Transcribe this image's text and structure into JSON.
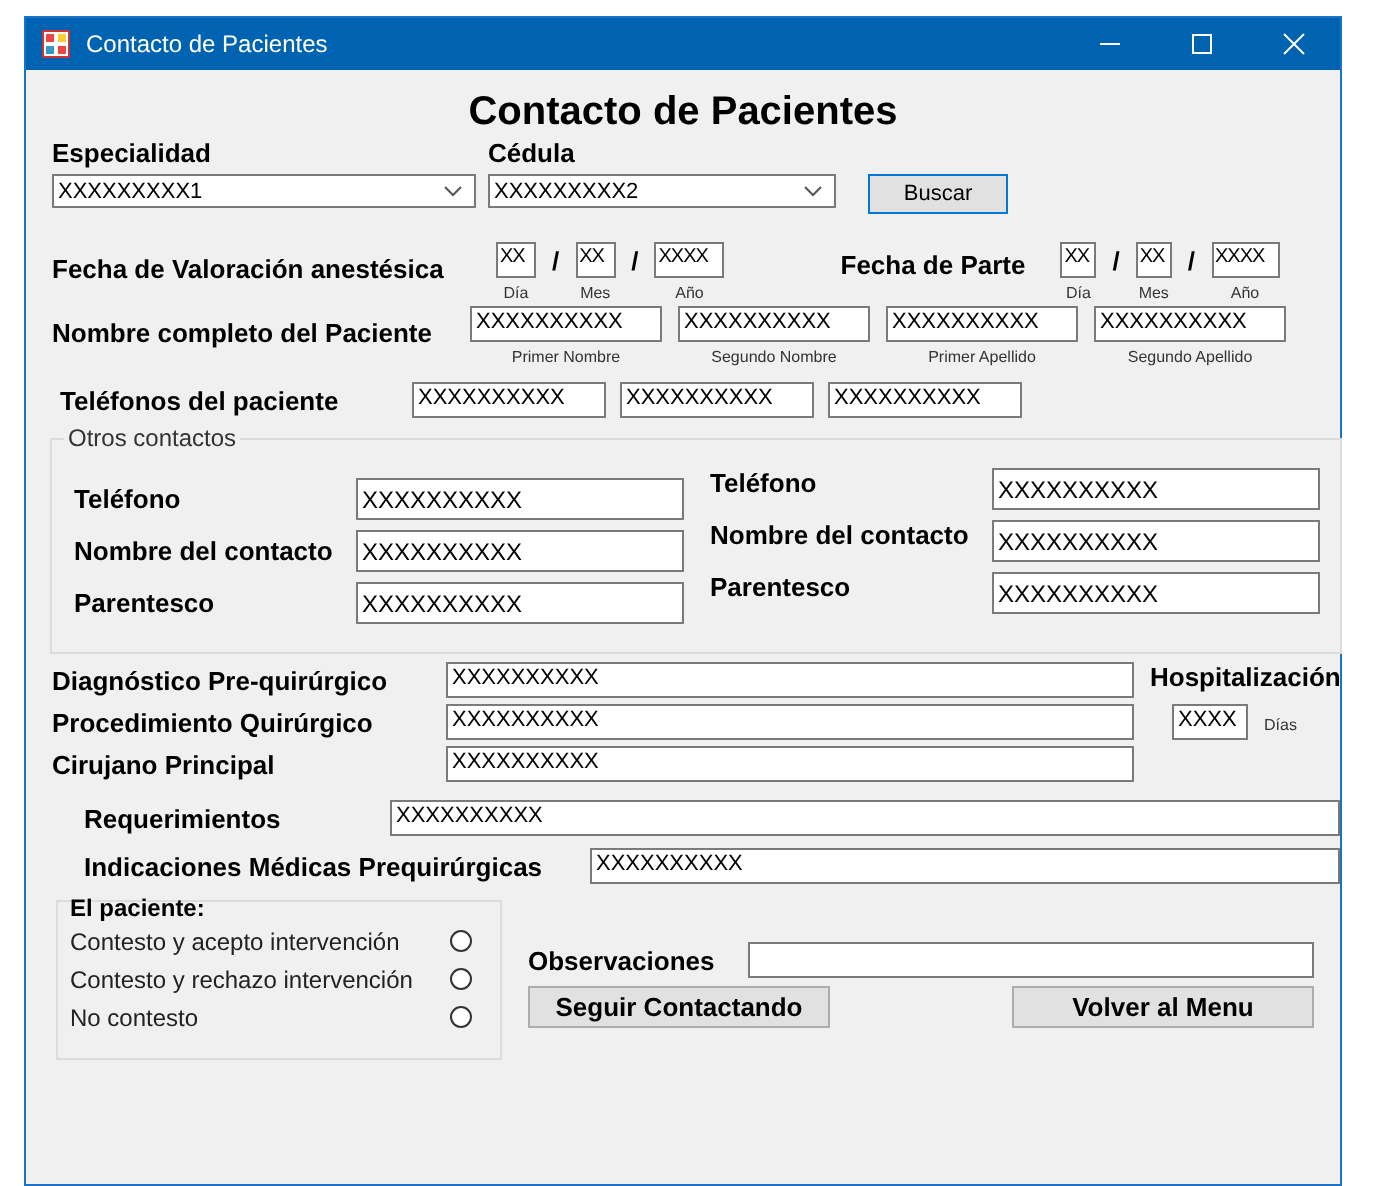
{
  "window": {
    "title": "Contacto de Pacientes"
  },
  "heading": "Contacto de Pacientes",
  "especialidad": {
    "label": "Especialidad",
    "value": "XXXXXXXXX1"
  },
  "cedula": {
    "label": "Cédula",
    "value": "XXXXXXXXX2"
  },
  "search_button": "Buscar",
  "fecha_valoracion": {
    "label": "Fecha de Valoración anestésica",
    "separator": "/",
    "fields": [
      {
        "value": "XX",
        "caption": "Día"
      },
      {
        "value": "XX",
        "caption": "Mes"
      },
      {
        "value": "XXXX",
        "caption": "Año"
      }
    ]
  },
  "fecha_parte": {
    "label": "Fecha de Parte",
    "separator": "/",
    "fields": [
      {
        "value": "XX",
        "caption": "Día"
      },
      {
        "value": "XX",
        "caption": "Mes"
      },
      {
        "value": "XXXX",
        "caption": "Año"
      }
    ]
  },
  "nombre": {
    "label": "Nombre completo del Paciente",
    "fields": [
      {
        "value": "XXXXXXXXXX",
        "caption": "Primer Nombre"
      },
      {
        "value": "XXXXXXXXXX",
        "caption": "Segundo Nombre"
      },
      {
        "value": "XXXXXXXXXX",
        "caption": "Primer Apellido"
      },
      {
        "value": "XXXXXXXXXX",
        "caption": "Segundo Apellido"
      }
    ]
  },
  "telefonos": {
    "label": "Teléfonos del paciente",
    "values": [
      "XXXXXXXXXX",
      "XXXXXXXXXX",
      "XXXXXXXXXX"
    ]
  },
  "otros_contactos": {
    "title": "Otros contactos",
    "columns": [
      [
        {
          "label": "Teléfono",
          "value": "XXXXXXXXXX"
        },
        {
          "label": "Nombre del contacto",
          "value": "XXXXXXXXXX"
        },
        {
          "label": "Parentesco",
          "value": "XXXXXXXXXX"
        }
      ],
      [
        {
          "label": "Teléfono",
          "value": "XXXXXXXXXX"
        },
        {
          "label": "Nombre del contacto",
          "value": "XXXXXXXXXX"
        },
        {
          "label": "Parentesco",
          "value": "XXXXXXXXXX"
        }
      ]
    ]
  },
  "diagnostico": {
    "label": "Diagnóstico Pre-quirúrgico",
    "value": "XXXXXXXXXX"
  },
  "hospitalizacion": {
    "label": "Hospitalización",
    "value": "XXXX",
    "unit": "Días"
  },
  "procedimiento": {
    "label": "Procedimiento Quirúrgico",
    "value": "XXXXXXXXXX"
  },
  "cirujano": {
    "label": "Cirujano Principal",
    "value": "XXXXXXXXXX"
  },
  "requerimientos": {
    "label": "Requerimientos",
    "value": "XXXXXXXXXX"
  },
  "indicaciones": {
    "label": "Indicaciones Médicas Prequirúrgicas",
    "value": "XXXXXXXXXX"
  },
  "el_paciente": {
    "title": "El paciente:",
    "options": [
      {
        "label": "Contesto y acepto intervención",
        "selected": false
      },
      {
        "label": "Contesto y rechazo intervención",
        "selected": false
      },
      {
        "label": "No contesto",
        "selected": false
      }
    ]
  },
  "observaciones": {
    "label": "Observaciones"
  },
  "buttons": [
    "Seguir Contactando",
    "Volver al Menu"
  ]
}
